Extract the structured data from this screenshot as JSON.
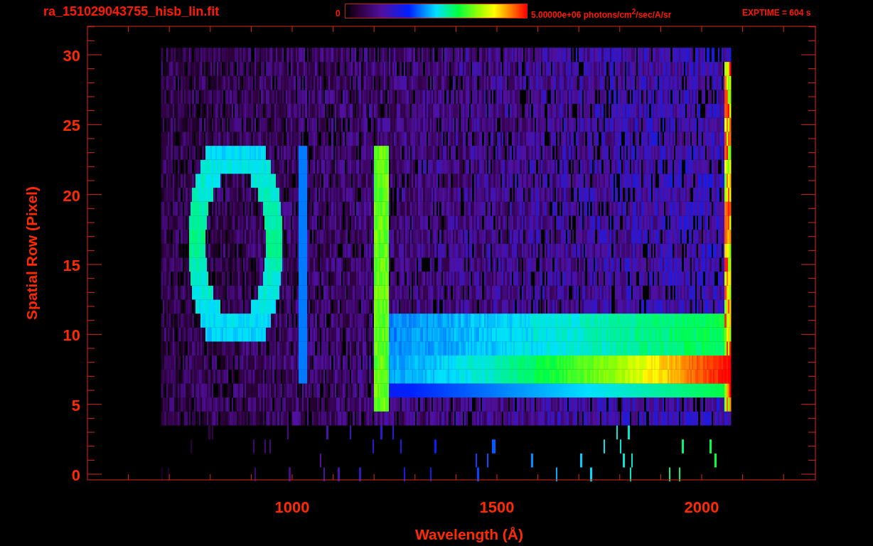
{
  "title": "ra_151029043755_hisb_lin.fit",
  "colorbar": {
    "min_label": "0",
    "max_label": "5.00000e+06 photons/cm$^{2}$/sec/A/sr"
  },
  "exposure": "EXPTIME = 604 s",
  "plot": {
    "xlabel": "Wavelength (Å)",
    "ylabel": "Spatial Row (Pixel)",
    "xticks": [
      "1000",
      "1500",
      "2000"
    ],
    "yticks": [
      "30",
      "25",
      "20",
      "15",
      "10",
      "5",
      "0"
    ]
  }
}
